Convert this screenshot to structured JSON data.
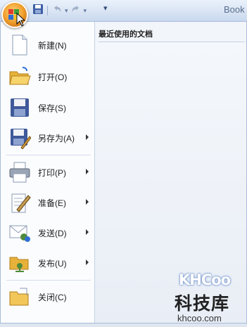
{
  "window": {
    "app_title": "Book"
  },
  "quick_access": {
    "icons": [
      "save-icon",
      "undo-icon",
      "redo-icon",
      "customize-icon"
    ]
  },
  "menu": {
    "items": [
      {
        "label": "新建(N)",
        "icon": "new-document-icon"
      },
      {
        "label": "打开(O)",
        "icon": "open-folder-icon"
      },
      {
        "label": "保存(S)",
        "icon": "save-disk-icon"
      },
      {
        "label": "另存为(A)",
        "icon": "save-as-icon",
        "submenu": true
      },
      {
        "label": "打印(P)",
        "icon": "printer-icon",
        "submenu": true
      },
      {
        "label": "准备(E)",
        "icon": "prepare-icon",
        "submenu": true
      },
      {
        "label": "发送(D)",
        "icon": "send-icon",
        "submenu": true
      },
      {
        "label": "发布(U)",
        "icon": "publish-icon",
        "submenu": true
      },
      {
        "label": "关闭(C)",
        "icon": "close-folder-icon"
      }
    ],
    "recent_header": "最近使用的文档"
  },
  "watermark": {
    "brand": "KHCoo",
    "chinese": "科技库",
    "url": "khcoo.com"
  }
}
